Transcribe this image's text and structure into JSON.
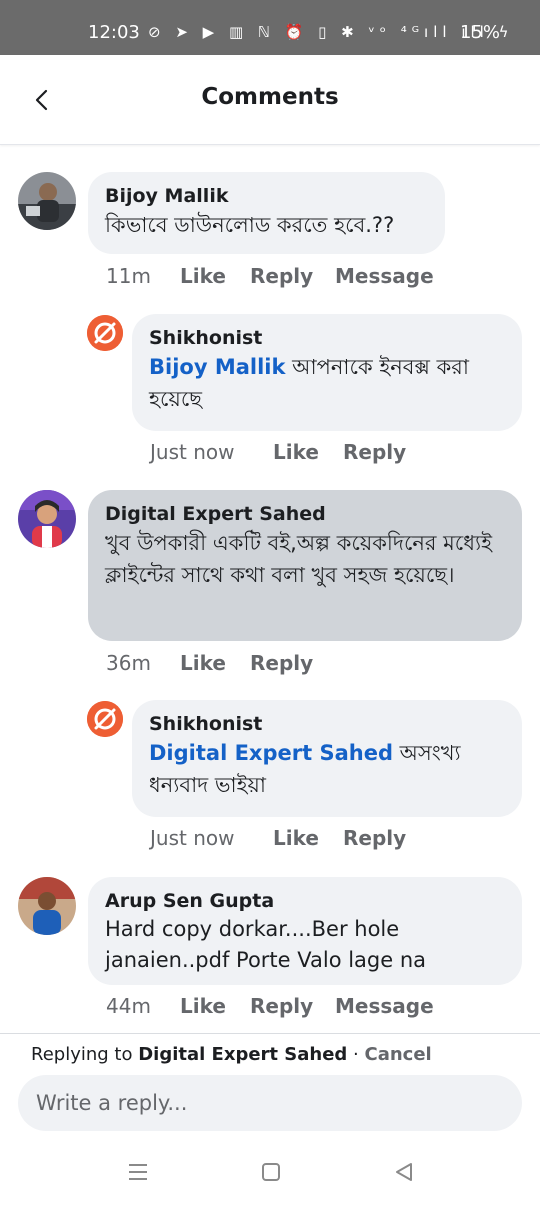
{
  "status_bar": {
    "time": "12:03",
    "icons_text": "⊘ ➤ ▶ ▥  ℕ ⏰ ▯ ✱ ᵛᵒ ⁴ᴳıll ıll ϟ",
    "battery": "15%"
  },
  "header": {
    "back_icon": "chevron-left-icon",
    "title": "Comments"
  },
  "comments": [
    {
      "author": "Bijoy Mallik",
      "text": "কিভাবে ডাউনলোড করতে হবে.??",
      "time": "11m",
      "actions": [
        "Like",
        "Reply",
        "Message"
      ]
    },
    {
      "author": "Shikhonist",
      "mention": "Bijoy Mallik",
      "text": " আপনাকে ইনবক্স করা হয়েছে",
      "time": "Just now",
      "actions": [
        "Like",
        "Reply"
      ]
    },
    {
      "author": "Digital Expert Sahed",
      "text": "খুব উপকারী একটি বই,অল্প কয়েকদিনের মধ্যেই ক্লাইন্টের সাথে কথা বলা খুব সহজ হয়েছে।",
      "time": "36m",
      "actions": [
        "Like",
        "Reply"
      ]
    },
    {
      "author": "Shikhonist",
      "mention": "Digital Expert Sahed",
      "text": " অসংখ্য ধন্যবাদ ভাইয়া",
      "time": "Just now",
      "actions": [
        "Like",
        "Reply"
      ]
    },
    {
      "author": "Arup Sen Gupta",
      "text": "Hard copy dorkar....Ber hole janaien..pdf Porte Valo lage na",
      "time": "44m",
      "actions": [
        "Like",
        "Reply",
        "Message"
      ]
    }
  ],
  "reply_bar": {
    "prefix": "Replying to ",
    "target": "Digital Expert Sahed",
    "separator": " · ",
    "cancel": "Cancel",
    "placeholder": "Write a reply..."
  },
  "colors": {
    "link": "#1461c7",
    "page_brand": "#ee5e34",
    "bubble": "#f0f2f5",
    "bubble_highlight": "#d0d4d9"
  }
}
